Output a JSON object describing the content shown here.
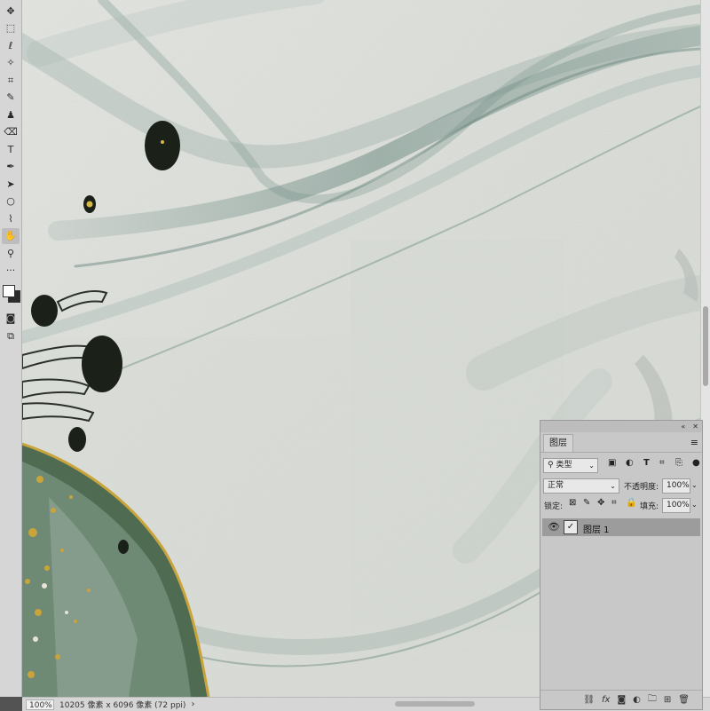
{
  "toolbar": {
    "tools": [
      {
        "name": "move-icon",
        "glyph": "✥"
      },
      {
        "name": "marquee-icon",
        "glyph": "⬚"
      },
      {
        "name": "lasso-icon",
        "glyph": "ℓ"
      },
      {
        "name": "magic-wand-icon",
        "glyph": "✧"
      },
      {
        "name": "crop-icon",
        "glyph": "⌗"
      },
      {
        "name": "brush-icon",
        "glyph": "✎"
      },
      {
        "name": "stamp-icon",
        "glyph": "♟"
      },
      {
        "name": "eraser-icon",
        "glyph": "⌫"
      },
      {
        "name": "type-icon",
        "glyph": "T"
      },
      {
        "name": "pen-icon",
        "glyph": "✒"
      },
      {
        "name": "path-selection-icon",
        "glyph": "➤"
      },
      {
        "name": "ellipse-icon",
        "glyph": "○"
      },
      {
        "name": "eyedropper-icon",
        "glyph": "⌇"
      },
      {
        "name": "hand-icon",
        "glyph": "✋"
      },
      {
        "name": "zoom-icon",
        "glyph": "⚲"
      },
      {
        "name": "more-tools-icon",
        "glyph": "···"
      }
    ],
    "foreground_color": "#ffffff",
    "background_color": "#2b2b2b"
  },
  "statusbar": {
    "zoom": "100%",
    "doc_info": "10205 像素 x 6096 像素 (72 ppi)",
    "arrow": "›"
  },
  "layers_panel": {
    "tab_label": "图层",
    "filter_label": "类型",
    "blend_mode": "正常",
    "opacity_label": "不透明度:",
    "opacity_value": "100%",
    "lock_label": "锁定:",
    "fill_label": "填充:",
    "fill_value": "100%",
    "layers": [
      {
        "name": "图层 1",
        "visible": true
      }
    ]
  },
  "colors": {
    "canvas_base": "#dee1dc",
    "silk": "#7d9890",
    "ink": "#1b2118",
    "gold": "#c9a43a",
    "green": "#4f6b52"
  }
}
